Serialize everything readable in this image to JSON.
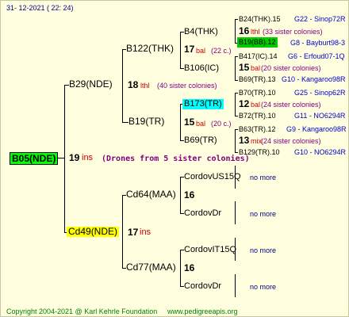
{
  "header": {
    "date": "31- 12-2021 ( 22: 24)"
  },
  "root": {
    "name": "B05(NDE)",
    "year": "19",
    "suffix": "ins",
    "drones": "(Drones from 5 sister colonies)"
  },
  "gen1": {
    "queen": {
      "name": "B29(NDE)",
      "year": "18",
      "line": "lthl",
      "colonies": "(40 sister colonies)"
    },
    "drone_mother": {
      "name": "Cd49(NDE)",
      "year": "17",
      "suffix": "ins"
    }
  },
  "gen2": {
    "b122": {
      "name": "B122(THK)",
      "year": "17",
      "line": "bal",
      "colonies": "(22 c.)"
    },
    "b19": {
      "name": "B19(TR)",
      "year": "15",
      "line": "bal",
      "colonies": "(20 c.)"
    },
    "cd64": {
      "name": "Cd64(MAA)",
      "year": "16"
    },
    "cd77": {
      "name": "Cd77(MAA)",
      "year": "16"
    }
  },
  "gen3": {
    "b4": {
      "name": "B4(THK)"
    },
    "b106": {
      "name": "B106(IC)"
    },
    "b173": {
      "name": "B173(TR)"
    },
    "b69": {
      "name": "B69(TR)"
    },
    "cordovus15q": {
      "name": "CordovUS15Q"
    },
    "cordovdr1": {
      "name": "CordovDr"
    },
    "cordovit15q": {
      "name": "CordovIT15Q"
    },
    "cordovdr2": {
      "name": "CordovDr"
    }
  },
  "gen4": [
    {
      "name": "B24(THK).15",
      "ref": "G22 - Sinop72R"
    },
    {
      "year": "16",
      "line": "lthl",
      "colonies": "(33 sister colonies)"
    },
    {
      "name": "B19(BB).12",
      "ref": "G8 - Bayburt98-3"
    },
    {
      "name": "B417(IC).14",
      "ref": "G6 - Erfoud07-1Q"
    },
    {
      "year": "15",
      "line": "bal",
      "colonies": "(20 sister colonies)"
    },
    {
      "name": "B69(TR).13",
      "ref": "G10 - Kangaroo98R"
    },
    {
      "name": "B70(TR).10",
      "ref": "G25 - Sinop62R"
    },
    {
      "year": "12",
      "line": "bal",
      "colonies": "(24 sister colonies)"
    },
    {
      "name": "B72(TR).10",
      "ref": "G11 - NO6294R"
    },
    {
      "name": "B63(TR).12",
      "ref": "G9 - Kangaroo98R"
    },
    {
      "year": "13",
      "line": "mix",
      "colonies": "(24 sister colonies)"
    },
    {
      "name": "B129(TR).10",
      "ref": "G10 - NO6294R"
    }
  ],
  "no_more": "no more",
  "footer": {
    "copyright": "Copyright 2004-2021 @ Karl Kehrle Foundation",
    "url": "www.pedigreeapis.org"
  },
  "colors": {
    "background": "#ffffe0",
    "root_fill": "#00ff00",
    "highlight_cyan": "#00ffff",
    "highlight_yellow": "#ffff00",
    "highlight_green": "#00cc00"
  }
}
